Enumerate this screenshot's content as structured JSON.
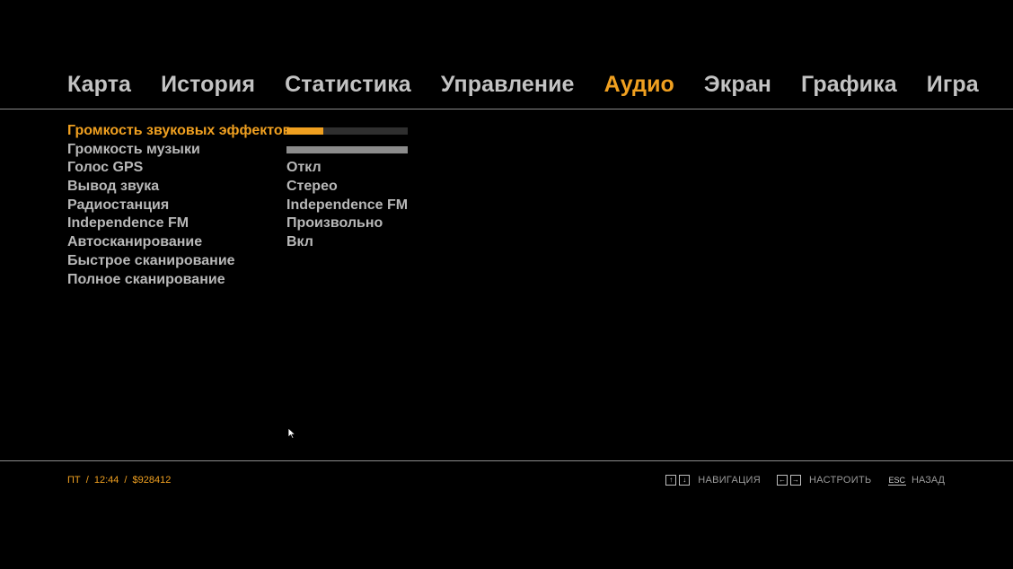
{
  "tabs": [
    {
      "label": "Карта",
      "active": false
    },
    {
      "label": "История",
      "active": false
    },
    {
      "label": "Статистика",
      "active": false
    },
    {
      "label": "Управление",
      "active": false
    },
    {
      "label": "Аудио",
      "active": true
    },
    {
      "label": "Экран",
      "active": false
    },
    {
      "label": "Графика",
      "active": false
    },
    {
      "label": "Игра",
      "active": false
    }
  ],
  "settings": {
    "labels": [
      "Громкость звуковых эффектов",
      "Громкость музыки",
      "Голос GPS",
      "Вывод звука",
      "Радиостанция",
      "Independence FM",
      "Автосканирование",
      "Быстрое сканирование",
      "Полное сканирование"
    ],
    "sfx_volume_percent": 30,
    "music_volume_percent": 100,
    "gps_voice": "Откл",
    "sound_output": "Стерео",
    "radio_station": "Independence FM",
    "independence_fm": "Произвольно",
    "auto_scan": "Вкл"
  },
  "status": {
    "day": "ПТ",
    "sep1": "/",
    "time": "12:44",
    "sep2": "/",
    "money": "$928412"
  },
  "hints": {
    "navigate_label": "НАВИГАЦИЯ",
    "adjust_label": "НАСТРОИТЬ",
    "back_key": "ESC",
    "back_label": "НАЗАД"
  },
  "colors": {
    "accent": "#f0a020",
    "text": "#c3c3c3",
    "background": "#000000"
  }
}
